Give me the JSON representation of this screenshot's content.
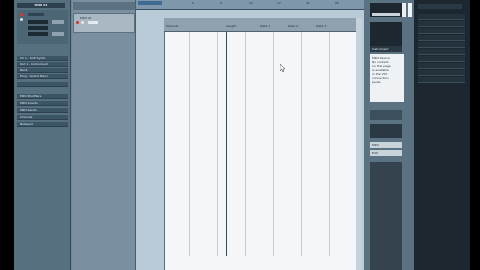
{
  "inspector": {
    "track_name": "MIDI 01",
    "sections": [
      "MIDI Modifiers",
      "MIDI Inserts",
      "MIDI Sends",
      "Channel",
      "Notepad"
    ],
    "output_rows": [
      "Ch 1 - Soft Synth",
      "Out 1 - Instrument",
      "Bank",
      "Prog - Grand Piano"
    ]
  },
  "tracklist": {
    "track_label": "MIDI 01",
    "part_label": "MIDI"
  },
  "ruler": {
    "ticks": [
      "5",
      "9",
      "13",
      "17",
      "21",
      "25"
    ]
  },
  "editor": {
    "header_cells": [
      "Channel",
      "Length",
      "Data 1",
      "Data 2",
      "Data 3"
    ]
  },
  "right_panel": {
    "top_label": "Instrument",
    "text_lines": [
      "MIDI Device",
      "No content",
      "on this page",
      "is available",
      "in the VST",
      "connection",
      "panel."
    ],
    "buttons": [
      "MIDI",
      "Edit"
    ]
  }
}
